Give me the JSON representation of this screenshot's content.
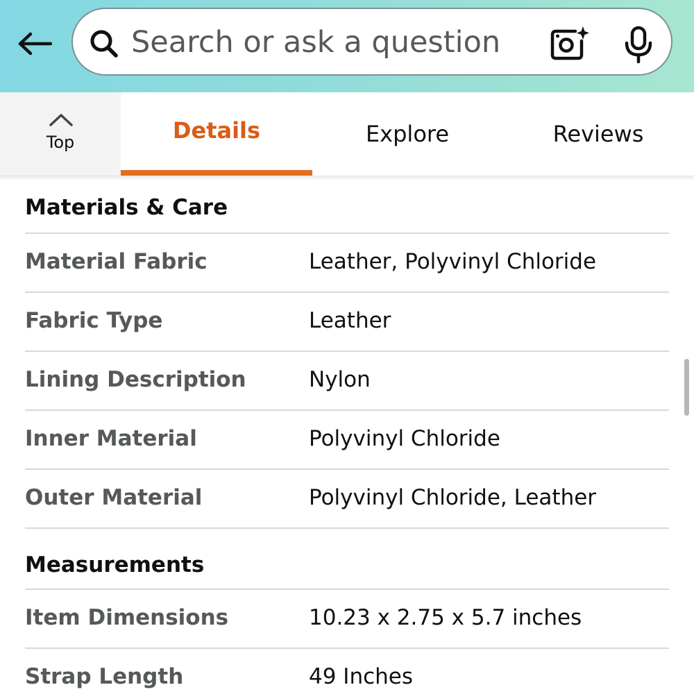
{
  "header": {
    "search_placeholder": "Search or ask a question",
    "icons": [
      "back-arrow-icon",
      "search-icon",
      "camera-lens-icon",
      "microphone-icon"
    ]
  },
  "tabs": {
    "top_label": "Top",
    "items": [
      {
        "label": "Details",
        "active": true
      },
      {
        "label": "Explore",
        "active": false
      },
      {
        "label": "Reviews",
        "active": false
      }
    ],
    "accent_color": "#d95c18"
  },
  "sections": [
    {
      "title": "Materials & Care",
      "rows": [
        {
          "label": "Material Fabric",
          "value": "Leather, Polyvinyl Chloride"
        },
        {
          "label": "Fabric Type",
          "value": "Leather"
        },
        {
          "label": "Lining Description",
          "value": "Nylon"
        },
        {
          "label": "Inner Material",
          "value": "Polyvinyl Chloride"
        },
        {
          "label": "Outer Material",
          "value": "Polyvinyl Chloride, Leather"
        }
      ]
    },
    {
      "title": "Measurements",
      "rows": [
        {
          "label": "Item Dimensions",
          "value": "10.23 x 2.75 x 5.7 inches"
        },
        {
          "label": "Strap Length",
          "value": "49 Inches"
        }
      ]
    }
  ]
}
